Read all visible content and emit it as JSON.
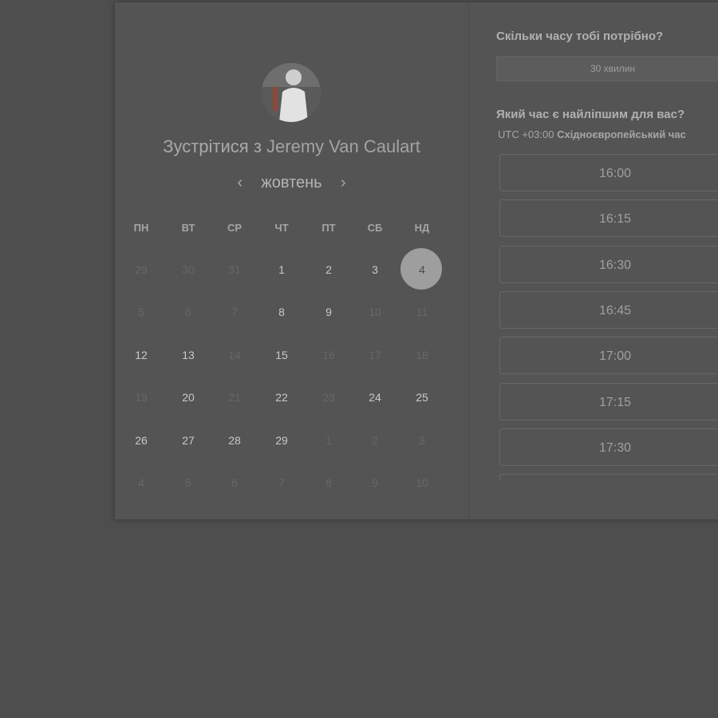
{
  "header": {
    "meet_prefix": "Зустрітися з",
    "host_name": "Jeremy Van Caulart",
    "month": "жовтень",
    "prev_icon": "‹",
    "next_icon": "›"
  },
  "weekdays": [
    "ПН",
    "ВТ",
    "СР",
    "ЧТ",
    "ПТ",
    "СБ",
    "НД"
  ],
  "weeks": [
    [
      {
        "d": "29",
        "on": false
      },
      {
        "d": "30",
        "on": false
      },
      {
        "d": "31",
        "on": false
      },
      {
        "d": "1",
        "on": true
      },
      {
        "d": "2",
        "on": true
      },
      {
        "d": "3",
        "on": true
      },
      {
        "d": "4",
        "on": true,
        "selected": true
      }
    ],
    [
      {
        "d": "5",
        "on": false
      },
      {
        "d": "6",
        "on": false
      },
      {
        "d": "7",
        "on": false
      },
      {
        "d": "8",
        "on": true
      },
      {
        "d": "9",
        "on": true
      },
      {
        "d": "10",
        "on": false
      },
      {
        "d": "11",
        "on": false
      }
    ],
    [
      {
        "d": "12",
        "on": true
      },
      {
        "d": "13",
        "on": true
      },
      {
        "d": "14",
        "on": false
      },
      {
        "d": "15",
        "on": true
      },
      {
        "d": "16",
        "on": false
      },
      {
        "d": "17",
        "on": false
      },
      {
        "d": "18",
        "on": false
      }
    ],
    [
      {
        "d": "19",
        "on": false
      },
      {
        "d": "20",
        "on": true
      },
      {
        "d": "21",
        "on": false
      },
      {
        "d": "22",
        "on": true
      },
      {
        "d": "23",
        "on": false
      },
      {
        "d": "24",
        "on": true
      },
      {
        "d": "25",
        "on": true
      }
    ],
    [
      {
        "d": "26",
        "on": true
      },
      {
        "d": "27",
        "on": true
      },
      {
        "d": "28",
        "on": true
      },
      {
        "d": "29",
        "on": true
      },
      {
        "d": "1",
        "on": false
      },
      {
        "d": "2",
        "on": false
      },
      {
        "d": "3",
        "on": false
      }
    ],
    [
      {
        "d": "4",
        "on": false
      },
      {
        "d": "5",
        "on": false
      },
      {
        "d": "6",
        "on": false
      },
      {
        "d": "7",
        "on": false
      },
      {
        "d": "8",
        "on": false
      },
      {
        "d": "9",
        "on": false
      },
      {
        "d": "10",
        "on": false
      }
    ]
  ],
  "duration": {
    "heading": "Скільки часу тобі потрібно?",
    "value": "30 хвилин"
  },
  "time": {
    "heading": "Який час є найліпшим для вас?",
    "tz_offset": "UTC +03:00",
    "tz_name": "Східноєвропейський час",
    "slots": [
      "16:00",
      "16:15",
      "16:30",
      "16:45",
      "17:00",
      "17:15",
      "17:30",
      ""
    ]
  }
}
